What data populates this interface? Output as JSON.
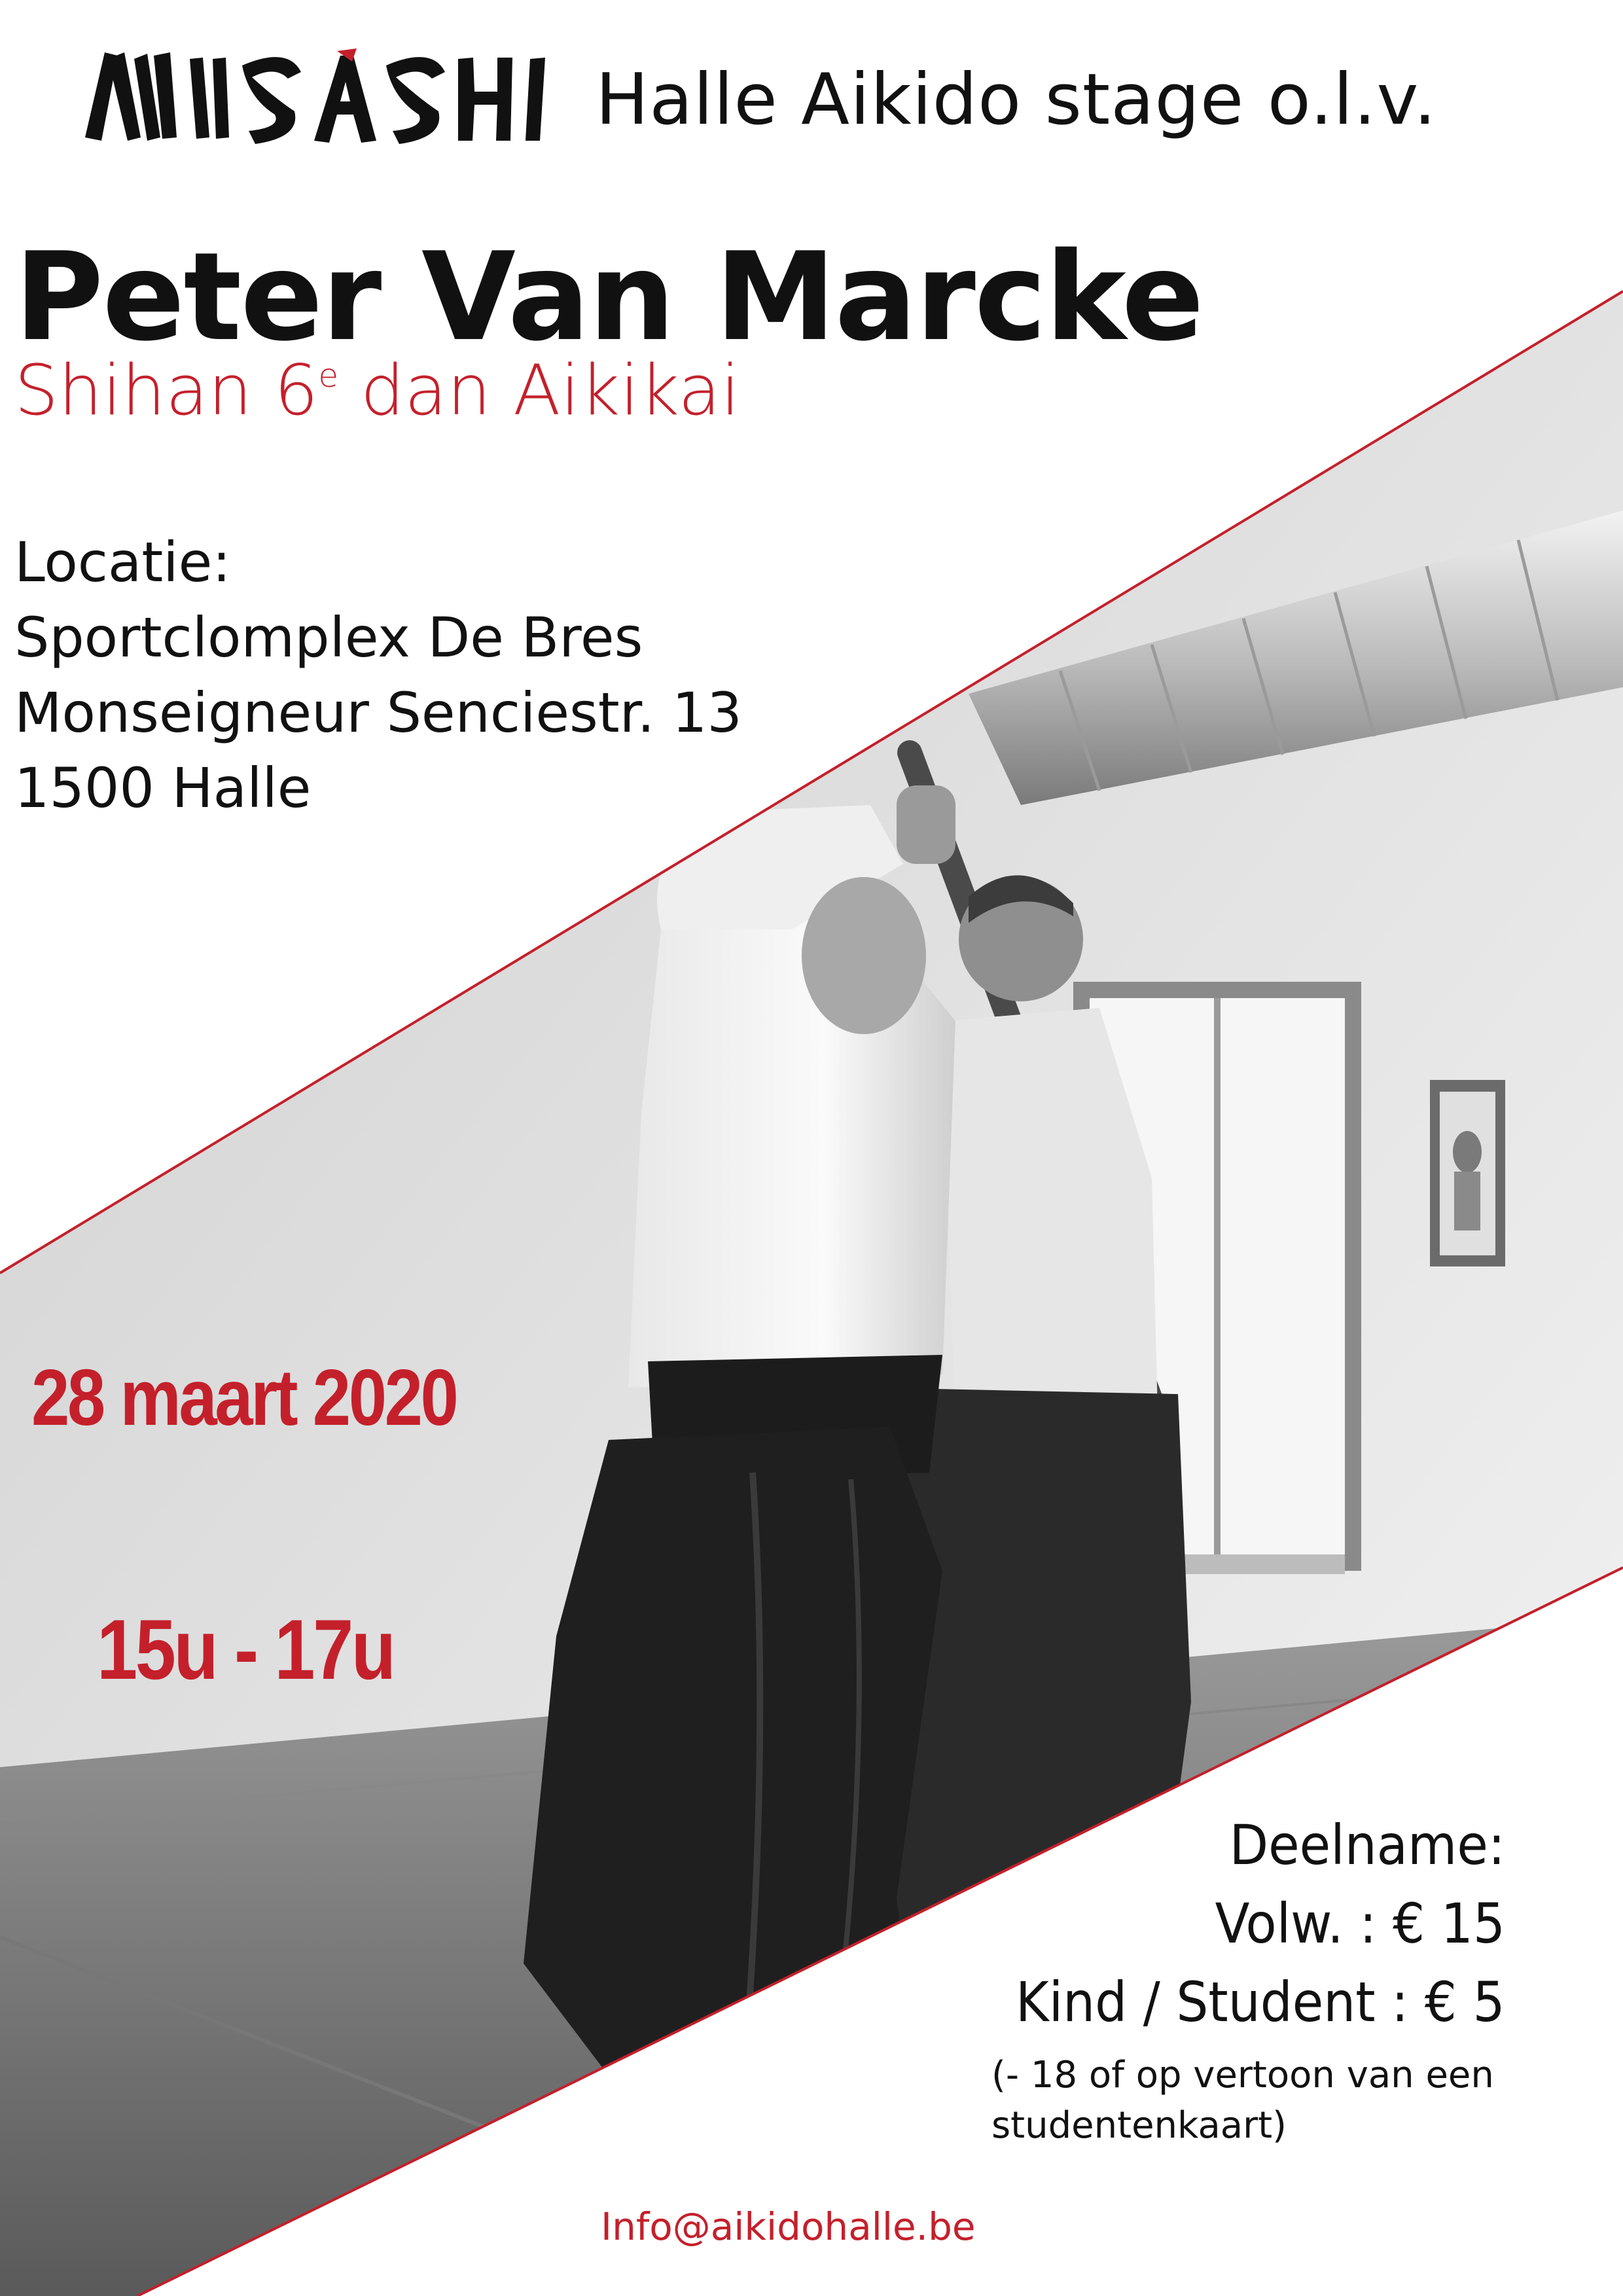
{
  "header": {
    "logo_text": "MUSASHI",
    "title": "Halle Aikido stage o.l.v."
  },
  "instructor": {
    "name": "Peter Van Marcke",
    "rank_prefix": "Shihan 6",
    "rank_sup": "e",
    "rank_suffix": " dan Aikikai"
  },
  "location": {
    "label": "Locatie:",
    "venue": "Sportclomplex De Bres",
    "street": "Monseigneur Senciestr. 13",
    "city": "1500 Halle"
  },
  "event": {
    "date": "28 maart 2020",
    "time": "15u - 17u"
  },
  "fees": {
    "label": "Deelname:",
    "adult": "Volw. : € 15",
    "child": "Kind / Student : € 5",
    "note_line1": "(- 18 of op vertoon van een",
    "note_line2": "studentenkaart)"
  },
  "contact": {
    "email": "Info@aikidohalle.be"
  },
  "colors": {
    "accent": "#c4202b",
    "text": "#111111",
    "background": "#ffffff"
  }
}
